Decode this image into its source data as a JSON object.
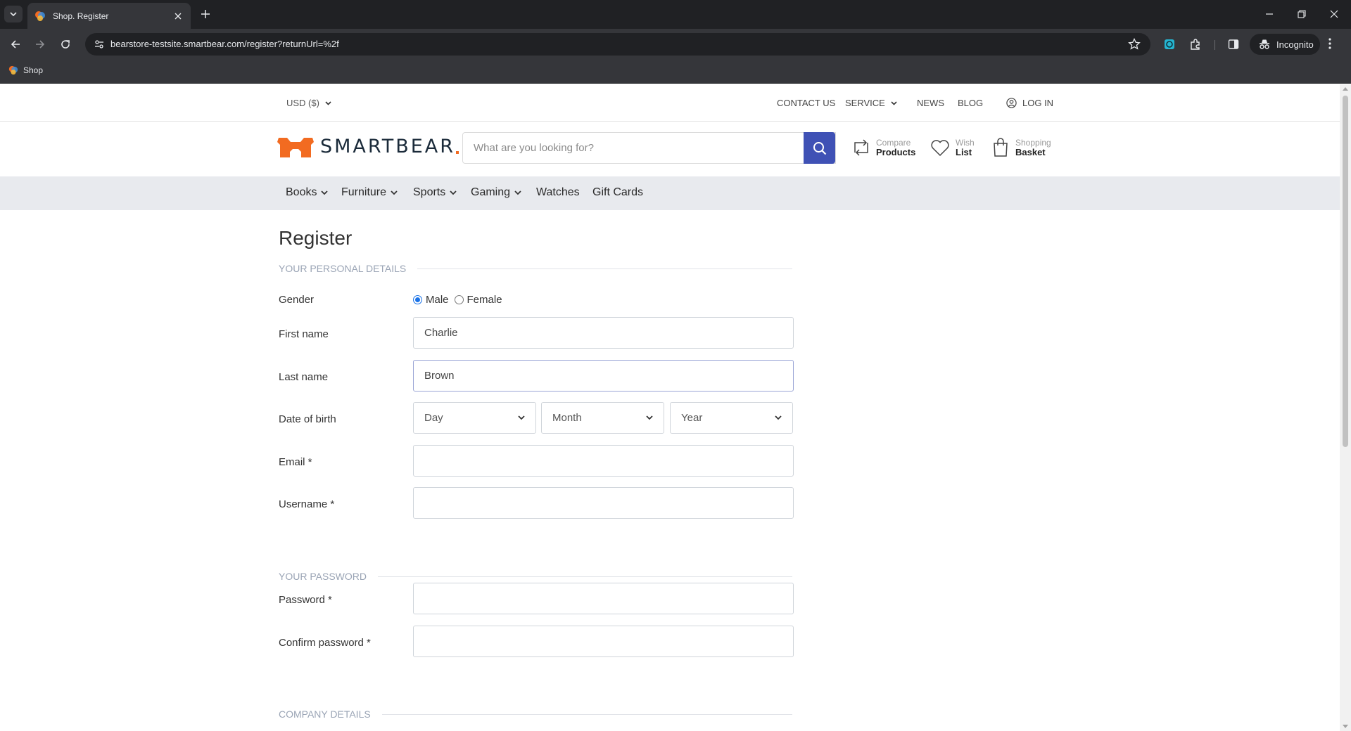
{
  "browser": {
    "tab_title": "Shop. Register",
    "url": "bearstore-testsite.smartbear.com/register?returnUrl=%2f",
    "profile_label": "Incognito",
    "bookmark_label": "Shop"
  },
  "topbar": {
    "currency": "USD  ($)",
    "contact": "CONTACT US",
    "service": "SERVICE",
    "news": "NEWS",
    "blog": "BLOG",
    "login": "LOG IN"
  },
  "header": {
    "logo_text": "SMARTBEAR",
    "search_placeholder": "What are you looking for?",
    "compare_line1": "Compare",
    "compare_line2": "Products",
    "wish_line1": "Wish",
    "wish_line2": "List",
    "basket_line1": "Shopping",
    "basket_line2": "Basket"
  },
  "menu": {
    "items": [
      "Books",
      "Furniture",
      "Sports",
      "Gaming",
      "Watches",
      "Gift Cards"
    ]
  },
  "form": {
    "title": "Register",
    "section_personal": "YOUR PERSONAL DETAILS",
    "gender_label": "Gender",
    "gender_male": "Male",
    "gender_female": "Female",
    "gender_selected": "Male",
    "first_name_label": "First name",
    "first_name_value": "Charlie",
    "last_name_label": "Last name",
    "last_name_value": "Brown",
    "dob_label": "Date of birth",
    "dob_day": "Day",
    "dob_month": "Month",
    "dob_year": "Year",
    "email_label": "Email *",
    "email_value": "",
    "username_label": "Username *",
    "username_value": "",
    "section_password": "YOUR PASSWORD",
    "password_label": "Password *",
    "confirm_label": "Confirm password *",
    "section_company": "COMPANY DETAILS"
  },
  "colors": {
    "brand_orange": "#f26b21",
    "brand_navy": "#1b2b3a",
    "accent_blue": "#3f51b5",
    "menubar_bg": "#e8eaee"
  }
}
